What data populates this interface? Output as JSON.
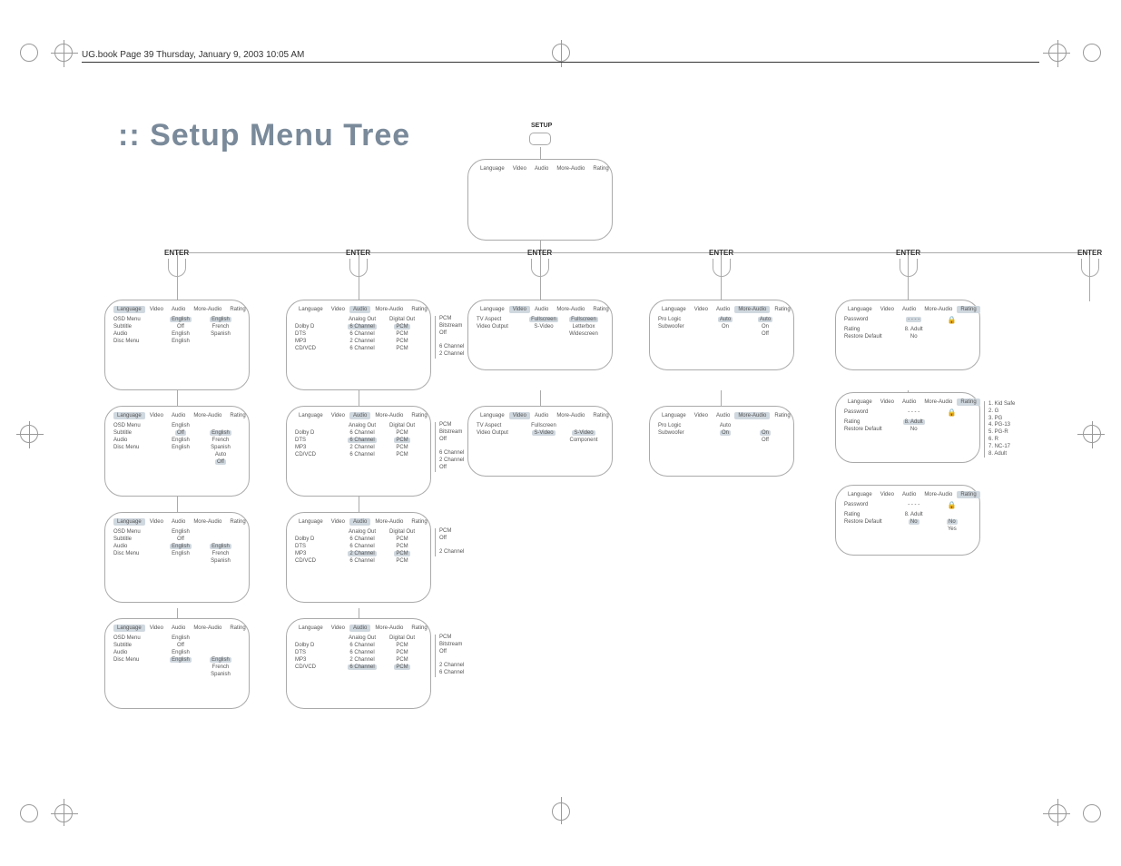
{
  "header": "UG.book  Page 39  Thursday, January 9, 2003  10:05 AM",
  "title": ":: Setup Menu Tree",
  "labels": {
    "setup": "SETUP",
    "enter": "ENTER"
  },
  "tabs": [
    "Language",
    "Video",
    "Audio",
    "More-Audio",
    "Rating"
  ],
  "language": {
    "rows": [
      "OSD Menu",
      "Subtitle",
      "Audio",
      "Disc Menu"
    ],
    "screens": [
      {
        "vals": [
          "English",
          "Off",
          "English",
          "English"
        ],
        "opts": [
          "English",
          "French",
          "Spanish"
        ],
        "sel_row": 0,
        "sel_opt": 0
      },
      {
        "vals": [
          "English",
          "Off",
          "English",
          "English"
        ],
        "opts": [
          "English",
          "French",
          "Spanish",
          "Auto",
          "Off"
        ],
        "sel_row": 1,
        "sel_opt": 4
      },
      {
        "vals": [
          "English",
          "Off",
          "English",
          "English"
        ],
        "opts": [
          "English",
          "French",
          "Spanish"
        ],
        "sel_row": 2,
        "sel_opt": 0
      },
      {
        "vals": [
          "English",
          "Off",
          "English",
          "English"
        ],
        "opts": [
          "English",
          "French",
          "Spanish"
        ],
        "sel_row": 3,
        "sel_opt": 0
      }
    ]
  },
  "audio": {
    "rows": [
      "Dolby D",
      "DTS",
      "MP3",
      "CD/VCD"
    ],
    "header": [
      "Analog Out",
      "Digital Out"
    ],
    "screens": [
      {
        "analog": [
          "6 Channel",
          "6 Channel",
          "2 Channel",
          "6 Channel"
        ],
        "digital": [
          "PCM",
          "PCM",
          "PCM",
          "PCM"
        ],
        "sel_row": 0,
        "side": [
          "PCM",
          "Bitstream",
          "Off",
          "",
          "6 Channel",
          "2 Channel"
        ]
      },
      {
        "analog": [
          "6 Channel",
          "6 Channel",
          "2 Channel",
          "6 Channel"
        ],
        "digital": [
          "PCM",
          "PCM",
          "PCM",
          "PCM"
        ],
        "sel_row": 1,
        "side": [
          "PCM",
          "Bitstream",
          "Off",
          "",
          "6 Channel",
          "2 Channel",
          "Off"
        ]
      },
      {
        "analog": [
          "6 Channel",
          "6 Channel",
          "2 Channel",
          "6 Channel"
        ],
        "digital": [
          "PCM",
          "PCM",
          "PCM",
          "PCM"
        ],
        "sel_row": 2,
        "side": [
          "PCM",
          "Off",
          "",
          "2 Channel"
        ]
      },
      {
        "analog": [
          "6 Channel",
          "6 Channel",
          "2 Channel",
          "6 Channel"
        ],
        "digital": [
          "PCM",
          "PCM",
          "PCM",
          "PCM"
        ],
        "sel_row": 3,
        "side": [
          "PCM",
          "Bitstream",
          "Off",
          "",
          "2 Channel",
          "6 Channel"
        ]
      }
    ]
  },
  "video": {
    "rows": [
      "TV Aspect",
      "Video Output"
    ],
    "screens": [
      {
        "vals": [
          "Fullscreen",
          "S-Video"
        ],
        "opts": [
          "Fullscreen",
          "Letterbox",
          "Widescreen"
        ],
        "sel_row": 0,
        "sel_opt": 0
      },
      {
        "vals": [
          "Fullscreen",
          "S-Video"
        ],
        "opts": [
          "S-Video",
          "Component"
        ],
        "sel_row": 1,
        "sel_opt": 0
      }
    ]
  },
  "moreaudio": {
    "rows": [
      "Pro Logic",
      "Subwoofer"
    ],
    "screens": [
      {
        "vals": [
          "Auto",
          "On"
        ],
        "opts": [
          "Auto",
          "On",
          "Off"
        ],
        "sel_row": 0,
        "sel_opt": 0
      },
      {
        "vals": [
          "Auto",
          "On"
        ],
        "opts": [
          "On",
          "Off"
        ],
        "sel_row": 1,
        "sel_opt": 0
      }
    ]
  },
  "rating": {
    "rows": [
      "Password",
      "Rating",
      "Restore Default"
    ],
    "screens": [
      {
        "vals": [
          "- - - -",
          "8. Adult",
          "No"
        ],
        "lock": true,
        "sel_row": 0
      },
      {
        "vals": [
          "- - - -",
          "8. Adult",
          "No"
        ],
        "lock": true,
        "sel_row": 1,
        "side": [
          "1. Kid Safe",
          "2. G",
          "3. PG",
          "4. PG-13",
          "5. PG-R",
          "6. R",
          "7. NC-17",
          "8. Adult"
        ]
      },
      {
        "vals": [
          "- - - -",
          "8. Adult",
          "No"
        ],
        "lock": true,
        "sel_row": 2,
        "opts": [
          "No",
          "Yes"
        ],
        "sel_opt": 0
      }
    ]
  }
}
